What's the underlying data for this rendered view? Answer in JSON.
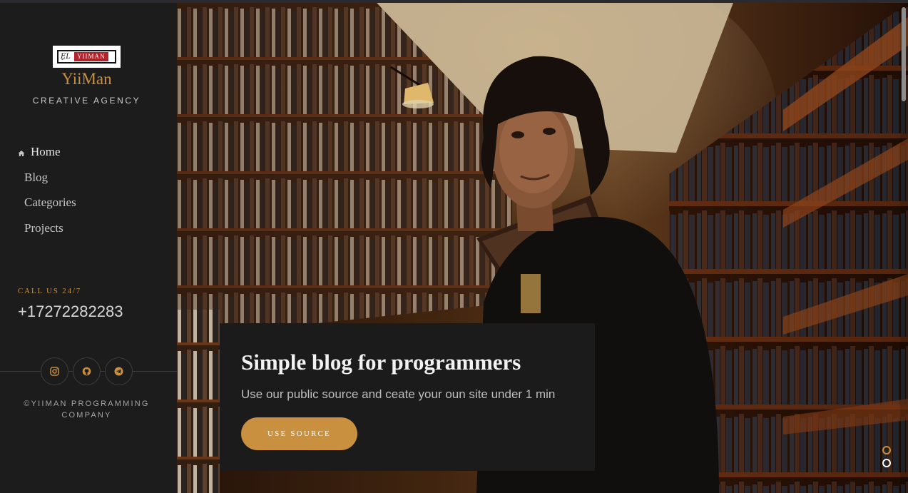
{
  "brand": {
    "logo_mark": "ȨL",
    "logo_word": "YIIMAN",
    "name": "YiiMan",
    "tagline": "CREATIVE AGENCY"
  },
  "nav": {
    "items": [
      {
        "label": "Home",
        "active": true,
        "icon": "home-icon"
      },
      {
        "label": "Blog",
        "active": false
      },
      {
        "label": "Categories",
        "active": false
      },
      {
        "label": "Projects",
        "active": false
      }
    ]
  },
  "contact": {
    "call_label": "CALL US 24/7",
    "phone": "+17272282283"
  },
  "socials": [
    {
      "name": "instagram",
      "icon": "instagram-icon"
    },
    {
      "name": "github",
      "icon": "github-icon"
    },
    {
      "name": "telegram",
      "icon": "telegram-icon"
    }
  ],
  "copyright": {
    "line1": "©YIIMAN PROGRAMMING",
    "line2": "COMPANY"
  },
  "hero": {
    "title": "Simple blog for programmers",
    "subtitle": "Use our public source and ceate your oun site under 1 min",
    "button_label": "USE SOURCE",
    "slides": 2,
    "active_slide": 1
  },
  "colors": {
    "accent": "#c8903f",
    "sidebar_bg": "#1c1c1c",
    "card_bg": "#1b1b1b"
  }
}
